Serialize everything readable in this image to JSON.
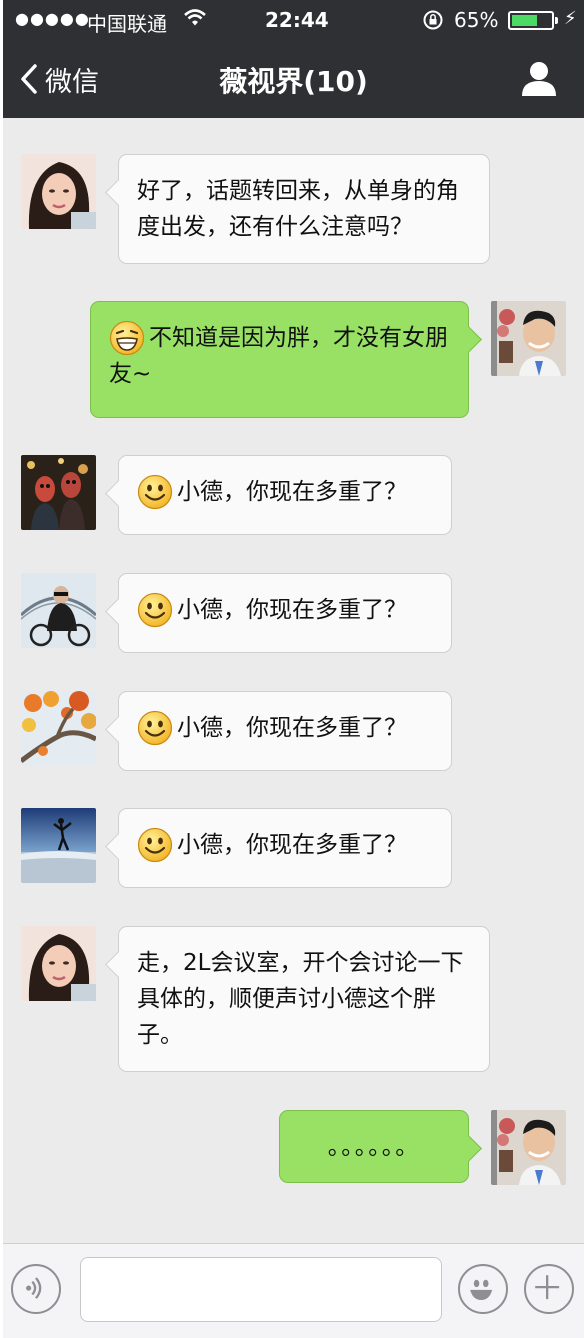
{
  "status_bar": {
    "signal": "●●●●●",
    "carrier": "中国联通",
    "time": "22:44",
    "battery_pct": "65%",
    "battery_level": 0.65,
    "battery_color": "#4cd964"
  },
  "nav": {
    "back_label": "微信",
    "title": "薇视界(10)"
  },
  "messages": [
    {
      "side": "left",
      "avatar": "avatar-woman",
      "text": "好了，话题转回来，从单身的角度出发，还有什么注意吗？"
    },
    {
      "side": "right",
      "avatar": "avatar-self",
      "emoji": "grinning-face",
      "text": "不知道是因为胖，才没有女朋友~"
    },
    {
      "side": "left",
      "avatar": "avatar-masks",
      "emoji": "smiley-face",
      "text": "小德，你现在多重了？"
    },
    {
      "side": "left",
      "avatar": "avatar-cyclist",
      "emoji": "smiley-face",
      "text": "小德，你现在多重了？"
    },
    {
      "side": "left",
      "avatar": "avatar-autumn-tree",
      "emoji": "smiley-face",
      "text": "小德，你现在多重了？"
    },
    {
      "side": "left",
      "avatar": "avatar-beach",
      "emoji": "smiley-face",
      "text": "小德，你现在多重了？"
    },
    {
      "side": "left",
      "avatar": "avatar-woman",
      "text": "走，2L会议室，开个会讨论一下具体的，顺便声讨小德这个胖子。"
    },
    {
      "side": "right",
      "avatar": "avatar-self",
      "text": "。。。。。。"
    }
  ],
  "input_bar": {
    "voice_icon": "voice-icon",
    "emoji_icon": "emoji-icon",
    "plus_icon": "plus-icon",
    "input_value": ""
  },
  "colors": {
    "header_bg": "#2f3033",
    "chat_bg": "#ebebeb",
    "sent_bubble": "#98e165",
    "received_bubble": "#fafafa"
  }
}
